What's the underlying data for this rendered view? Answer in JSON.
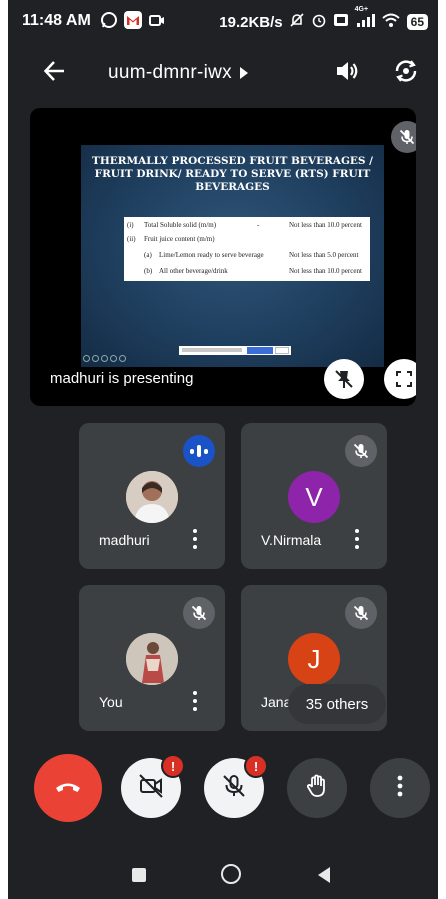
{
  "status_bar": {
    "time": "11:48 AM",
    "network_speed": "19.2KB/s",
    "network_type": "4G+",
    "battery": "65",
    "icons": [
      "whatsapp-icon",
      "gmail-icon",
      "video-notification-icon",
      "mute-icon",
      "alarm-icon",
      "volte-icon",
      "signal-icon",
      "wifi-icon",
      "battery-icon"
    ]
  },
  "header": {
    "meeting_code": "uum-dmnr-iwx",
    "icons": [
      "back-arrow-icon",
      "chevron-right-icon",
      "speaker-icon",
      "switch-camera-icon"
    ]
  },
  "presentation": {
    "presenter_label": "madhuri is presenting",
    "slide": {
      "title": "THERMALLY PROCESSED FRUIT BEVERAGES / FRUIT DRINK/ READY TO SERVE (RTS) FRUIT BEVERAGES",
      "rows": [
        {
          "num": "(i)",
          "item": "Total Soluble solid (m/m)",
          "mid": "-",
          "req": "Not less than 10.0 percent"
        },
        {
          "num": "(ii)",
          "item": "Fruit juice content (m/m)",
          "mid": "",
          "req": ""
        },
        {
          "num": "(a)",
          "item": "Lime/Lemon ready to serve beverage",
          "mid": "",
          "req": "Not less than 5.0 percent"
        },
        {
          "num": "(b)",
          "item": "All other beverage/drink",
          "mid": "",
          "req": "Not less than 10.0 percent"
        }
      ]
    }
  },
  "participants": [
    {
      "name": "madhuri",
      "initial": "",
      "avatar_color": "#e9e0d6",
      "status": "speaking"
    },
    {
      "name": "V.Nirmala",
      "initial": "V",
      "avatar_color": "#8e24aa",
      "status": "muted"
    },
    {
      "name": "You",
      "initial": "",
      "avatar_color": "#c9bfb4",
      "status": "muted"
    },
    {
      "name": "Janak",
      "initial": "J",
      "avatar_color": "#d84315",
      "status": "muted"
    }
  ],
  "others_count_label": "35 others",
  "controls": {
    "end_call": "end-call-icon",
    "camera": "camera-off-icon",
    "mic": "mic-off-icon",
    "raise_hand": "raise-hand-icon",
    "more": "more-options-icon",
    "badge_label": "!"
  },
  "colors": {
    "background": "#202124",
    "tile": "#3c4043",
    "end_call": "#ea4335",
    "alert": "#d93025",
    "speaking": "#1a53c7"
  }
}
